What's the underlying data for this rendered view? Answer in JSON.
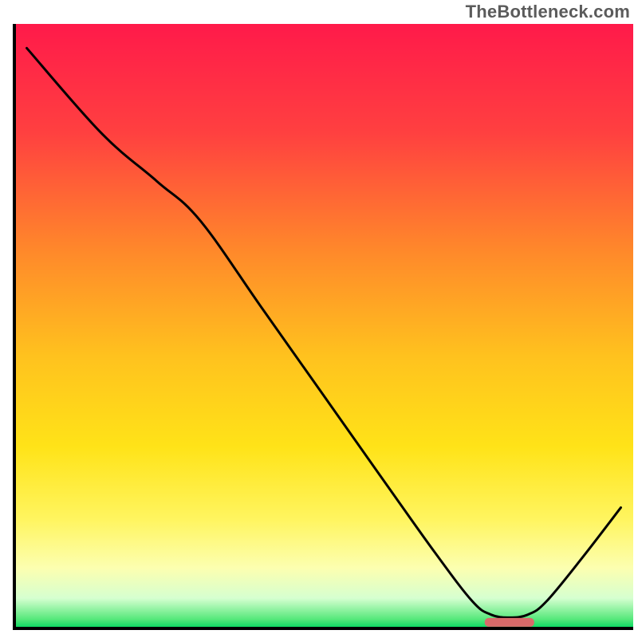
{
  "watermark": "TheBottleneck.com",
  "chart_data": {
    "type": "line",
    "title": "",
    "xlabel": "",
    "ylabel": "",
    "xlim": [
      0,
      100
    ],
    "ylim": [
      0,
      100
    ],
    "grid": false,
    "curve": [
      {
        "x": 2,
        "y": 96
      },
      {
        "x": 14,
        "y": 82
      },
      {
        "x": 23,
        "y": 74
      },
      {
        "x": 30,
        "y": 67.5
      },
      {
        "x": 40,
        "y": 53
      },
      {
        "x": 50,
        "y": 38.5
      },
      {
        "x": 60,
        "y": 24
      },
      {
        "x": 68,
        "y": 12.5
      },
      {
        "x": 74,
        "y": 4.5
      },
      {
        "x": 77,
        "y": 2.3
      },
      {
        "x": 80,
        "y": 1.8
      },
      {
        "x": 83,
        "y": 2.3
      },
      {
        "x": 86,
        "y": 4.5
      },
      {
        "x": 92,
        "y": 12
      },
      {
        "x": 98,
        "y": 20
      }
    ],
    "optimum_region": {
      "x_start": 76,
      "x_end": 84,
      "y": 1.0
    },
    "gradient_stops": [
      {
        "offset": 0.0,
        "color": "#ff1a4a"
      },
      {
        "offset": 0.18,
        "color": "#ff4040"
      },
      {
        "offset": 0.38,
        "color": "#ff8a2a"
      },
      {
        "offset": 0.55,
        "color": "#ffc21e"
      },
      {
        "offset": 0.7,
        "color": "#ffe318"
      },
      {
        "offset": 0.82,
        "color": "#fff560"
      },
      {
        "offset": 0.9,
        "color": "#fcffb0"
      },
      {
        "offset": 0.95,
        "color": "#d6ffd0"
      },
      {
        "offset": 0.985,
        "color": "#55e87a"
      },
      {
        "offset": 1.0,
        "color": "#00d960"
      }
    ],
    "marker_color": "#d86a6a",
    "curve_color": "#000000",
    "curve_width": 3
  },
  "plot": {
    "margin_left": 18,
    "margin_right": 6,
    "margin_top": 30,
    "margin_bottom": 12
  }
}
